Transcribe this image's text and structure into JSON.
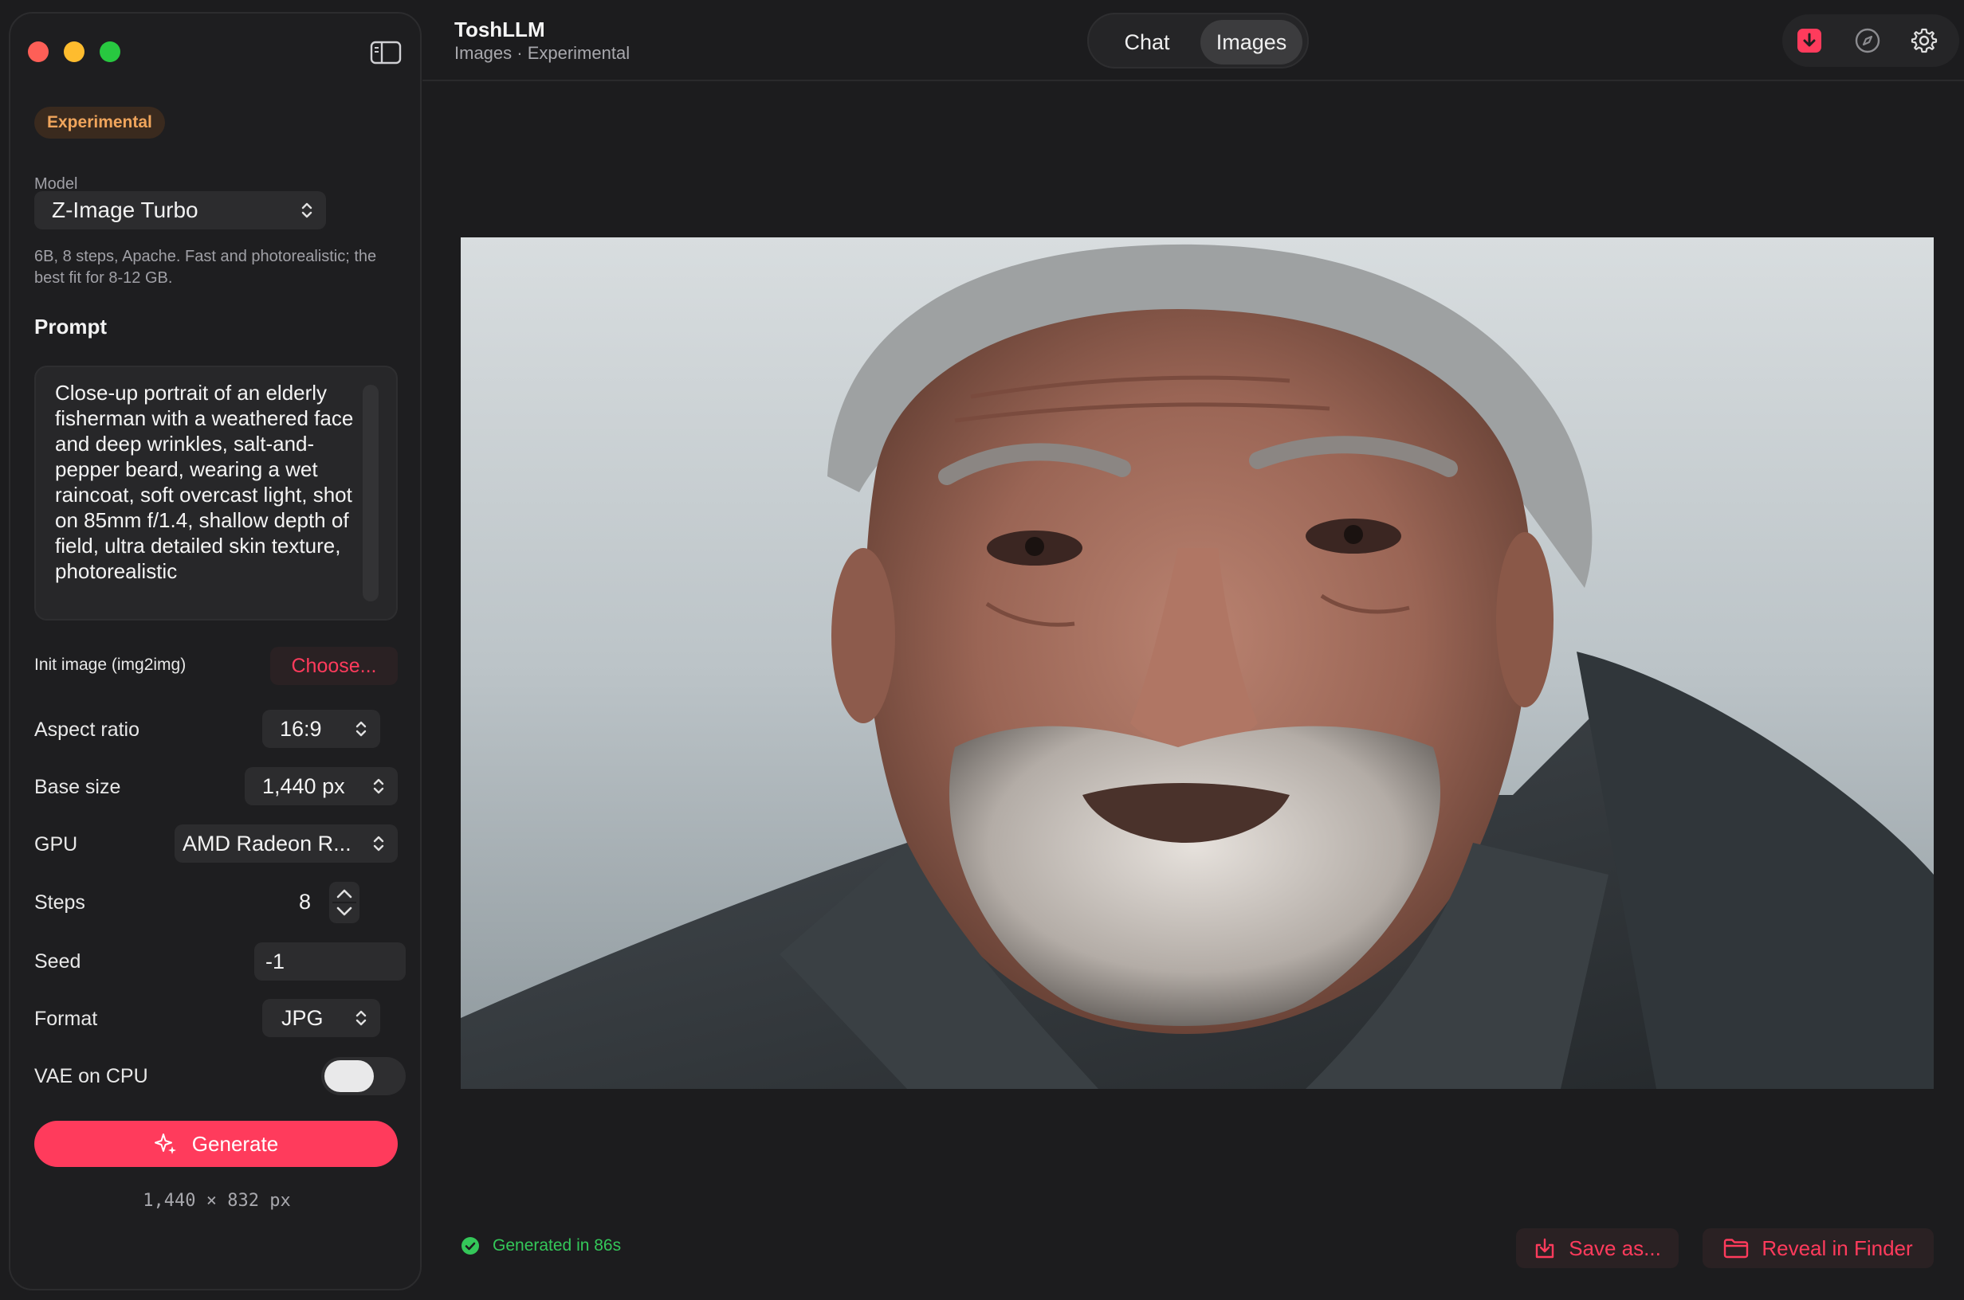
{
  "app": {
    "title": "ToshLLM",
    "subtitle": "Images · Experimental"
  },
  "tabs": {
    "chat": "Chat",
    "images": "Images",
    "active": "images"
  },
  "header_icons": [
    "download-icon",
    "compass-icon",
    "gear-icon"
  ],
  "sidebar": {
    "badge": "Experimental",
    "model_label": "Model",
    "model_value": "Z-Image Turbo",
    "model_desc": "6B, 8 steps, Apache. Fast and photorealistic; the best fit for 8-12 GB.",
    "prompt_label": "Prompt",
    "prompt_text": "Close-up portrait of an elderly fisherman with a weathered face and deep wrinkles, salt-and-pepper beard, wearing a wet raincoat, soft overcast light, shot on 85mm f/1.4, shallow depth of field, ultra detailed skin texture, photorealistic",
    "init_image_label": "Init image (img2img)",
    "choose_label": "Choose...",
    "aspect_label": "Aspect ratio",
    "aspect_value": "16:9",
    "base_label": "Base size",
    "base_value": "1,440 px",
    "gpu_label": "GPU",
    "gpu_value": "AMD Radeon R...",
    "steps_label": "Steps",
    "steps_value": "8",
    "seed_label": "Seed",
    "seed_value": "-1",
    "format_label": "Format",
    "format_value": "JPG",
    "vae_label": "VAE on CPU",
    "vae_on": true,
    "generate_label": "Generate",
    "dims": "1,440 × 832 px"
  },
  "footer": {
    "status": "Generated in 86s",
    "save_label": "Save as...",
    "reveal_label": "Reveal in Finder"
  },
  "colors": {
    "accent": "#ff3b5c",
    "success": "#34c759",
    "badge_text": "#f0a55c",
    "background": "#1c1c1e"
  }
}
